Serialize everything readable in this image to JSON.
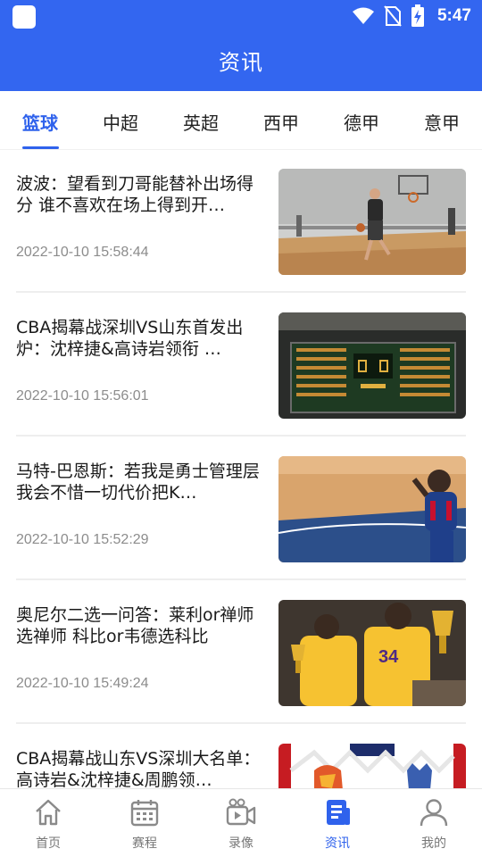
{
  "status_bar": {
    "time": "5:47"
  },
  "header": {
    "title": "资讯"
  },
  "tabs": [
    {
      "label": "篮球",
      "active": true
    },
    {
      "label": "中超",
      "active": false
    },
    {
      "label": "英超",
      "active": false
    },
    {
      "label": "西甲",
      "active": false
    },
    {
      "label": "德甲",
      "active": false
    },
    {
      "label": "意甲",
      "active": false
    }
  ],
  "news": [
    {
      "title": "波波：望看到刀哥能替补出场得分 谁不喜欢在场上得到开…",
      "time": "2022-10-10 15:58:44",
      "image": "basketball-practice-photo"
    },
    {
      "title": "CBA揭幕战深圳VS山东首发出炉：沈梓捷&高诗岩领衔 …",
      "time": "2022-10-10 15:56:01",
      "image": "arena-scoreboard-photo"
    },
    {
      "title": "马特-巴恩斯：若我是勇士管理层 我会不惜一切代价把K…",
      "time": "2022-10-10 15:52:29",
      "image": "player-on-court-photo"
    },
    {
      "title": "奥尼尔二选一问答：莱利or禅师选禅师 科比or韦德选科比",
      "time": "2022-10-10 15:49:24",
      "image": "players-with-trophies-photo"
    },
    {
      "title": "CBA揭幕战山东VS深圳大名单：高诗岩&沈梓捷&周鹏领…",
      "time": "",
      "image": "team-logos-graphic"
    }
  ],
  "bottom_nav": [
    {
      "label": "首页",
      "icon": "home-icon",
      "active": false
    },
    {
      "label": "赛程",
      "icon": "calendar-icon",
      "active": false
    },
    {
      "label": "录像",
      "icon": "video-icon",
      "active": false
    },
    {
      "label": "资讯",
      "icon": "news-icon",
      "active": true
    },
    {
      "label": "我的",
      "icon": "profile-icon",
      "active": false
    }
  ],
  "colors": {
    "primary": "#3366f0",
    "active": "#2f62ec",
    "text": "#1a1a1a",
    "muted": "#8c8c8c"
  }
}
